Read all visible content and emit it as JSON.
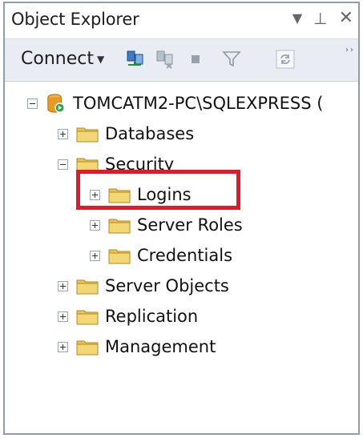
{
  "window": {
    "title": "Object Explorer",
    "controls": {
      "dropdown": "▾",
      "pin": "ꟼ",
      "close": "✕"
    }
  },
  "toolbar": {
    "connect_label": "Connect",
    "icons": [
      "connect-object-explorer-icon",
      "disconnect-icon",
      "stop-icon",
      "filter-icon",
      "refresh-icon"
    ],
    "overflow": "››"
  },
  "tree": {
    "server": "TOMCATM2-PC\\SQLEXPRESS (",
    "items": [
      {
        "label": "Databases",
        "expanded": false
      },
      {
        "label": "Security",
        "expanded": true,
        "children": [
          {
            "label": "Logins"
          },
          {
            "label": "Server Roles"
          },
          {
            "label": "Credentials"
          }
        ]
      },
      {
        "label": "Server Objects",
        "expanded": false
      },
      {
        "label": "Replication",
        "expanded": false
      },
      {
        "label": "Management",
        "expanded": false
      }
    ]
  },
  "colors": {
    "highlight": "#e01a2a",
    "folder": "#e8c158",
    "toolbar_bg": "#e9ecf2",
    "border": "#8e9cae"
  }
}
